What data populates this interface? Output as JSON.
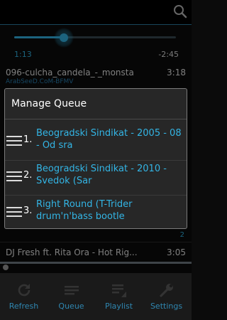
{
  "player": {
    "elapsed": "1:13",
    "remaining": "-2:45",
    "progress": 0.33
  },
  "tracks": [
    {
      "title": "096-culcha_candela_-_monsta",
      "duration": "3:18",
      "subtitle": "ArabSeeD.CoM-BFMV"
    }
  ],
  "queue_dialog": {
    "title": "Manage Queue",
    "items": [
      {
        "number": "1.",
        "name": "Beogradski Sindikat - 2005 - 08 - Od sra"
      },
      {
        "number": "2.",
        "name": "Beogradski Sindikat - 2010 - Svedok (Sar"
      },
      {
        "number": "3.",
        "name": "Right Round (T-Trider drum'n'bass bootle"
      }
    ]
  },
  "list_bottom_number": "2",
  "now_playing": {
    "title": "DJ Fresh ft. Rita Ora - Hot Rig...",
    "duration": "3:05"
  },
  "bottom_bar": [
    {
      "label": "Refresh",
      "icon": "refresh-icon"
    },
    {
      "label": "Queue",
      "icon": "queue-icon"
    },
    {
      "label": "Playlist",
      "icon": "playlist-icon"
    },
    {
      "label": "Settings",
      "icon": "wrench-icon"
    }
  ],
  "colors": {
    "accent": "#33b5e5",
    "dialog_bg": "#272727"
  }
}
